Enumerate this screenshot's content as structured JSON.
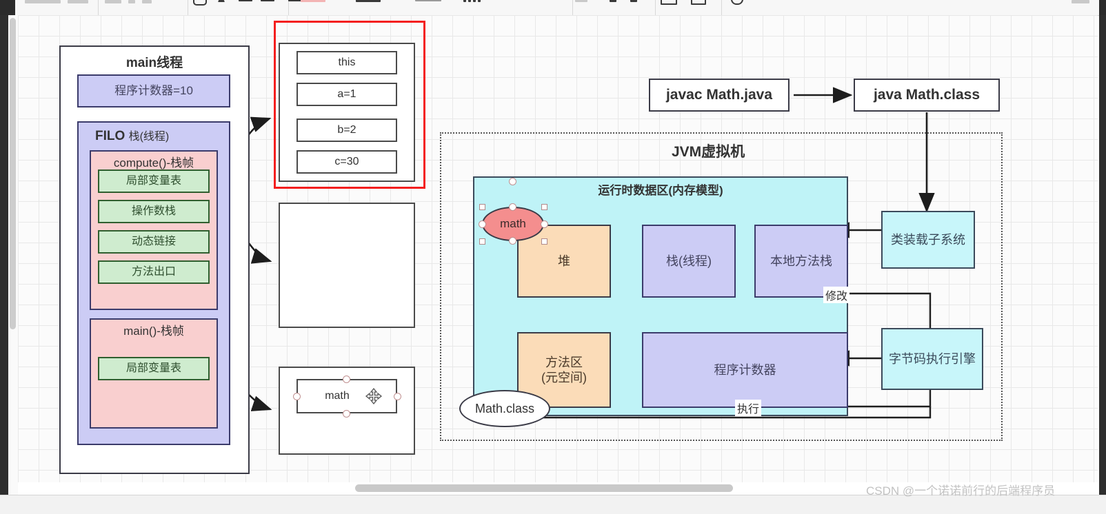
{
  "app": {
    "watermark": "CSDN @一个诺诺前行的后端程序员"
  },
  "toolbar": {
    "groups": [
      "format-group",
      "font-group",
      "align-group",
      "line-group",
      "arrange-group",
      "shape-group",
      "edit-group"
    ]
  },
  "diagram": {
    "main_thread": {
      "title": "main线程",
      "counter": "程序计数器=10",
      "stack_title_bold": "FILO",
      "stack_title_rest": "栈(线程)",
      "frames": [
        {
          "title": "compute()-栈帧",
          "slots": [
            "局部变量表",
            "操作数栈",
            "动态链接",
            "方法出口"
          ]
        },
        {
          "title": "main()-栈帧",
          "slots": [
            "局部变量表"
          ]
        }
      ]
    },
    "selected_locals": {
      "rows": [
        "this",
        "a=1",
        "b=2",
        "c=30"
      ]
    },
    "empty_box": {
      "label": ""
    },
    "math_box": {
      "label": "math"
    },
    "pipeline": {
      "compile_cmd": "javac Math.java",
      "run_cmd": "java Math.class"
    },
    "jvm": {
      "title": "JVM虚拟机",
      "runtime_area_title": "运行时数据区(内存模型)",
      "heap": "堆",
      "stack": "栈(线程)",
      "native_stack": "本地方法栈",
      "method_area_line1": "方法区",
      "method_area_line2": "(元空间)",
      "pc_register": "程序计数器",
      "math_instance": "math",
      "class_file": "Math.class",
      "class_loader": "类装载子系统",
      "exec_engine": "字节码执行引擎",
      "edge_modify": "修改",
      "edge_execute": "执行"
    }
  },
  "colors": {
    "selection_red": "#f41e1e",
    "purple_fill": "#ccccf5",
    "pink_fill": "#f9cfcf",
    "green_fill": "#cfeccf",
    "cyan_fill": "#bff3f7",
    "orange_fill": "#fbdcb8",
    "math_red": "#f48e8e"
  }
}
